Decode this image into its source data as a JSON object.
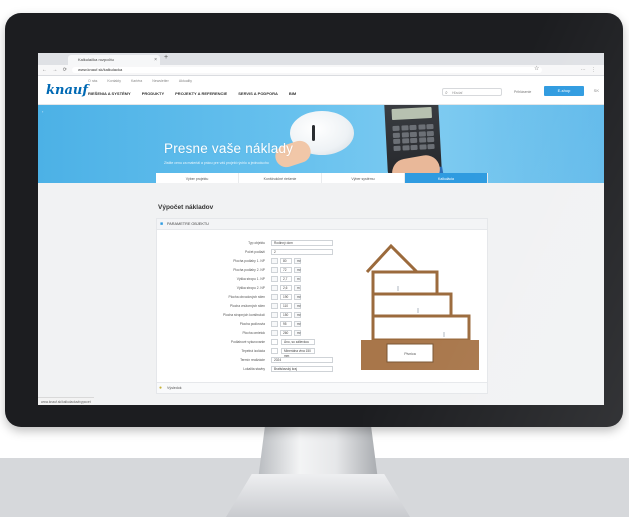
{
  "browser": {
    "tab_title": "Kalkulačka rozpočtu",
    "tab_close": "×",
    "new_tab": "+",
    "nav_icons": "← → ⟳",
    "url": "www.knauf.sk/kalkulacka",
    "bookmark": "☆",
    "extensions": "⋯ ⋮"
  },
  "site": {
    "logo": "knauf",
    "top_links": [
      "O nás",
      "Kontakty",
      "Kariéra",
      "Newsletter",
      "Aktuality"
    ],
    "main_nav": [
      "RIEŠENIA A SYSTÉMY",
      "PRODUKTY",
      "PROJEKTY A REFERENCIE",
      "SERVIS A PODPORA",
      "BIM"
    ],
    "search_placeholder": "Hľadať",
    "search_icon": "⌕",
    "login": "Prihlásenie",
    "shop": "E-shop",
    "lang": "SK"
  },
  "hero": {
    "strip_label": "‹",
    "title": "Presne vaše náklady",
    "subtitle": "Zistite cenu za materiál a prácu pre váš projekt rýchlo a jednoducho"
  },
  "process_tabs": [
    {
      "label": "Výber projektu",
      "active": false
    },
    {
      "label": "Konštrukčné riešenie",
      "active": false
    },
    {
      "label": "Výber systému",
      "active": false
    },
    {
      "label": "Kalkulácia",
      "active": true
    }
  ],
  "page": {
    "heading": "Výpočet nákladov"
  },
  "panel": {
    "icon": "■",
    "header": "PARAMETRE OBJEKTU",
    "footer_icon": "●",
    "footer": "Výsledok"
  },
  "form_rows": [
    {
      "label": "Typ objektu",
      "kind": "select",
      "value": "Rodinný dom"
    },
    {
      "label": "Počet podlaží",
      "kind": "select",
      "value": "2"
    },
    {
      "label": "Plocha podlahy 1. NP",
      "kind": "num",
      "values": [
        "",
        "80",
        "m²"
      ]
    },
    {
      "label": "Plocha podlahy 2. NP",
      "kind": "num",
      "values": [
        "",
        "72",
        "m²"
      ]
    },
    {
      "label": "Výška stropu 1. NP",
      "kind": "num",
      "values": [
        "",
        "2,7",
        "m"
      ]
    },
    {
      "label": "Výška stropu 2. NP",
      "kind": "num",
      "values": [
        "",
        "2,6",
        "m"
      ]
    },
    {
      "label": "Plocha obvodových stien",
      "kind": "num",
      "values": [
        "",
        "190",
        "m²"
      ]
    },
    {
      "label": "Plocha vnútorných stien",
      "kind": "num",
      "values": [
        "",
        "110",
        "m²"
      ]
    },
    {
      "label": "Plocha stropných konštrukcií",
      "kind": "num",
      "values": [
        "",
        "150",
        "m²"
      ]
    },
    {
      "label": "Plocha podkrovia",
      "kind": "num",
      "values": [
        "",
        "95",
        "m²"
      ]
    },
    {
      "label": "Plocha omietok",
      "kind": "num",
      "values": [
        "",
        "260",
        "m²"
      ]
    },
    {
      "label": "Podlahové vykurovanie",
      "kind": "check",
      "values": [
        "",
        "Áno, so zálievkou"
      ]
    },
    {
      "label": "Tepelná izolácia",
      "kind": "check",
      "values": [
        "",
        "Minerálna vlna 150 mm"
      ]
    },
    {
      "label": "Termín realizácie",
      "kind": "select",
      "value": "2024"
    },
    {
      "label": "Lokalita stavby",
      "kind": "select",
      "value": "Bratislavský kraj"
    }
  ],
  "house": {
    "basement_label": "Pivnica"
  },
  "statusbar": "www.knauf.sk/kalkulacka#vypocet",
  "colors": {
    "accent": "#2f9be0",
    "brand": "#0069b4",
    "hero": "#67c1ee",
    "wood": "#9b6a3c"
  }
}
